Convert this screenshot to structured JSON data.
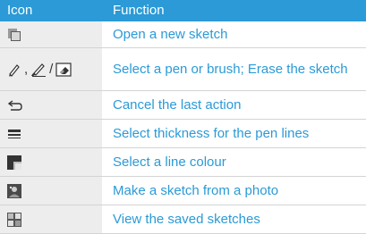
{
  "header": {
    "icon_col": "Icon",
    "function_col": "Function"
  },
  "rows": [
    {
      "icon": "new-sketch-icon",
      "function": "Open a new sketch"
    },
    {
      "icon": "pen-brush-eraser-icons",
      "separator1": ",",
      "separator2": "/",
      "function": "Select a pen or brush; Erase the sketch"
    },
    {
      "icon": "undo-arrow-icon",
      "function": "Cancel the last action"
    },
    {
      "icon": "line-thickness-icon",
      "function": "Select thickness for the pen lines"
    },
    {
      "icon": "line-colour-icon",
      "function": "Select a line colour"
    },
    {
      "icon": "photo-sketch-icon",
      "function": "Make a sketch from a photo"
    },
    {
      "icon": "saved-sketches-icon",
      "function": "View the saved sketches"
    }
  ],
  "colors": {
    "header_bg": "#2b9ad6",
    "function_text": "#2b9ad6",
    "icon_cell_bg": "#ededed"
  }
}
